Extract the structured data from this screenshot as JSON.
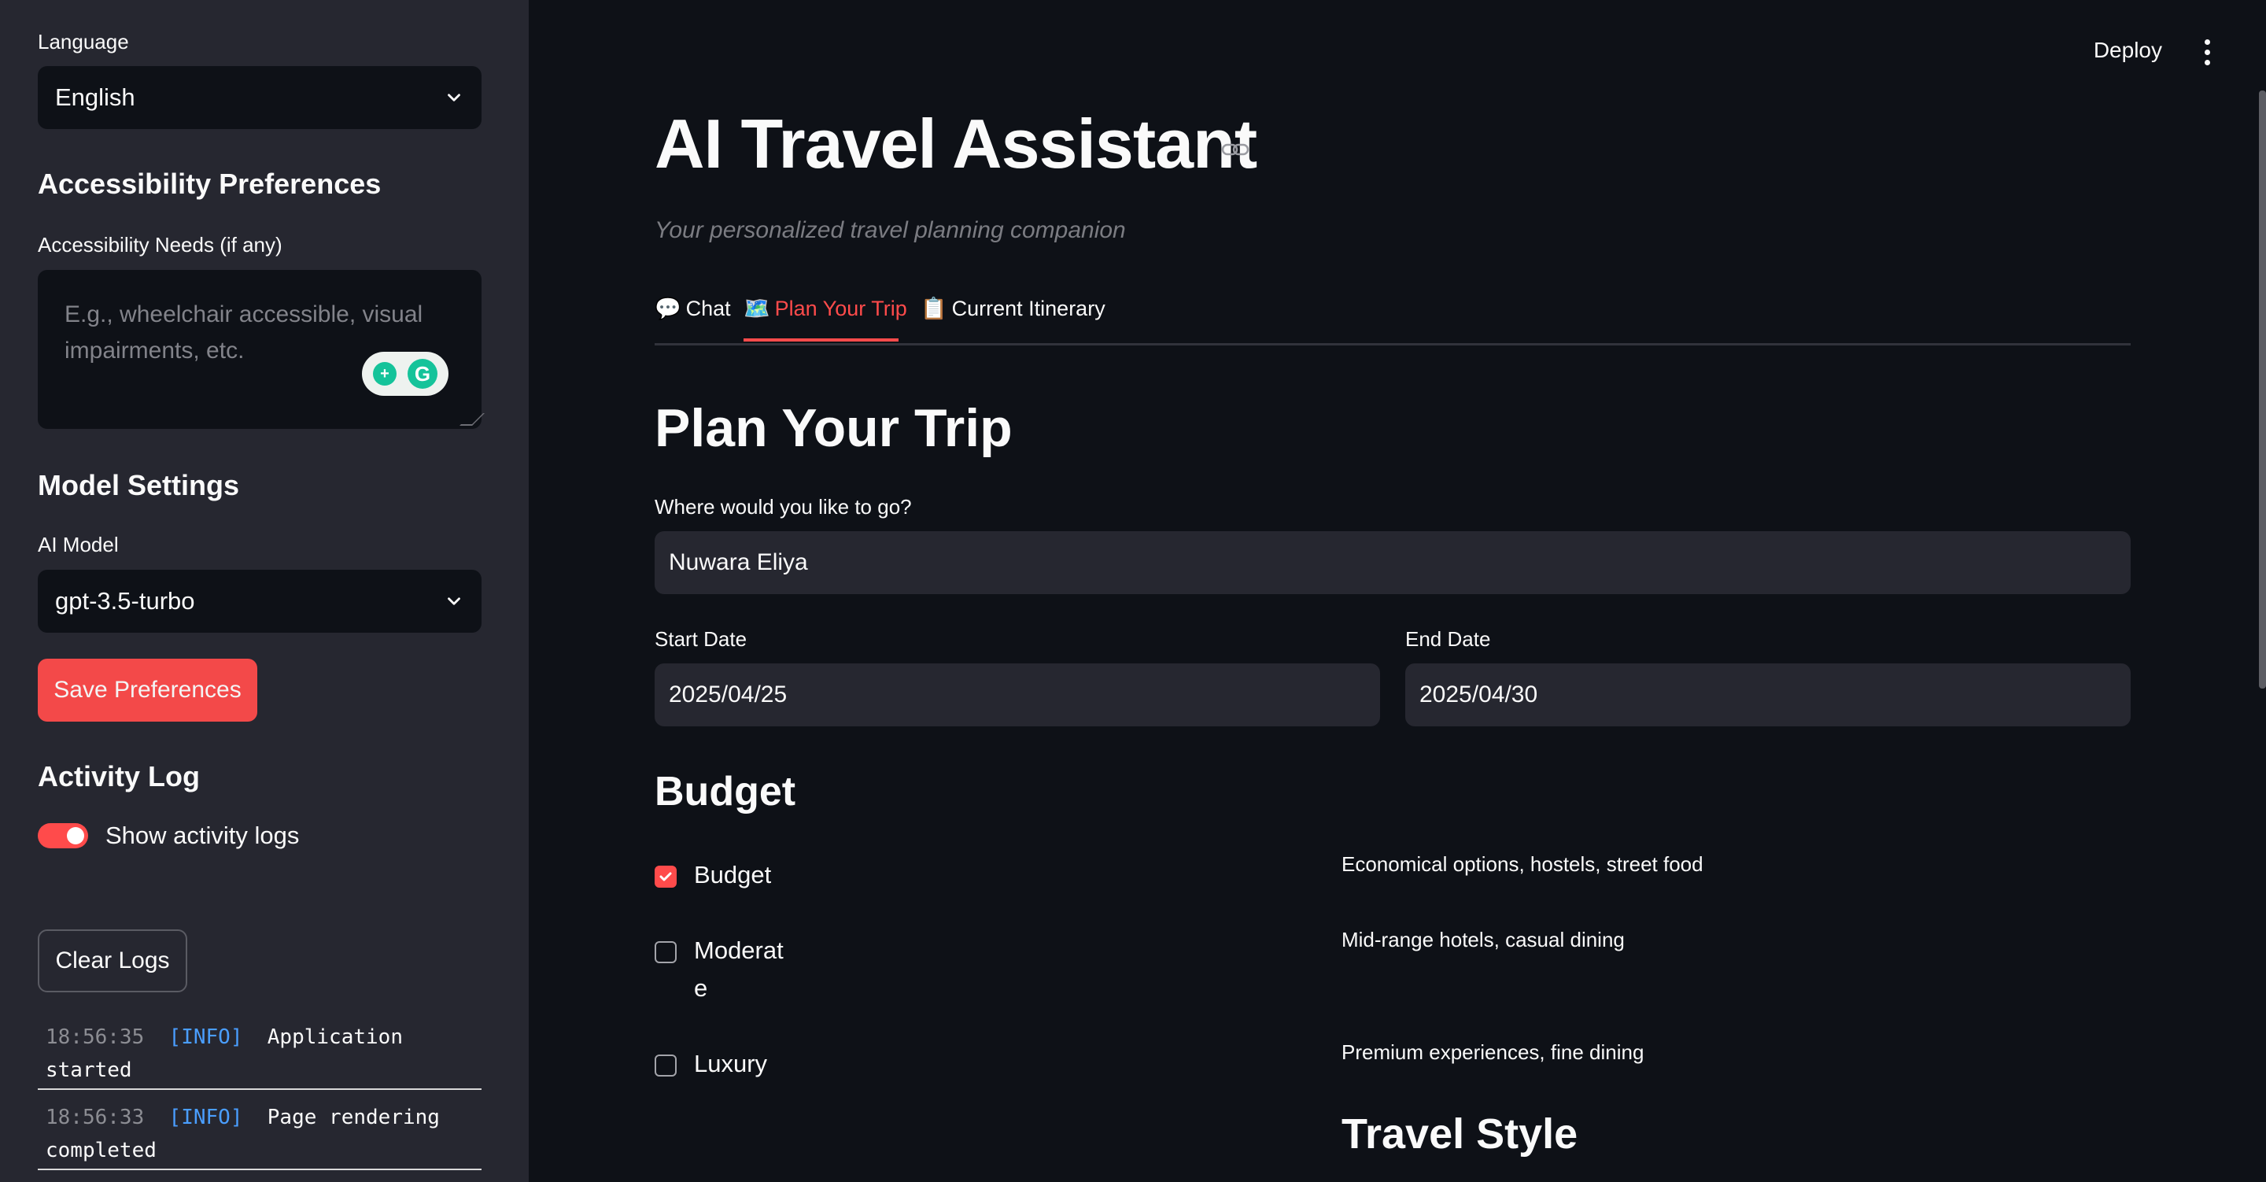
{
  "sidebar": {
    "language_label": "Language",
    "language_value": "English",
    "accessibility_heading": "Accessibility Preferences",
    "accessibility_label": "Accessibility Needs (if any)",
    "accessibility_placeholder": "E.g., wheelchair accessible, visual impairments, etc.",
    "model_heading": "Model Settings",
    "model_label": "AI Model",
    "model_value": "gpt-3.5-turbo",
    "save_button": "Save Preferences",
    "activity_heading": "Activity Log",
    "toggle_label": "Show activity logs",
    "toggle_on": true,
    "clear_button": "Clear Logs",
    "logs": [
      {
        "time": "18:56:35",
        "level": "[INFO]",
        "message": "Application started"
      },
      {
        "time": "18:56:33",
        "level": "[INFO]",
        "message": "Page rendering completed"
      }
    ]
  },
  "header": {
    "deploy": "Deploy",
    "menu_icon": "kebab-menu-icon"
  },
  "main": {
    "title": "AI Travel Assistant",
    "subtitle": "Your personalized travel planning companion",
    "tabs": [
      {
        "icon": "💬",
        "label": "Chat",
        "active": false
      },
      {
        "icon": "🗺️",
        "label": "Plan Your Trip",
        "active": true
      },
      {
        "icon": "📋",
        "label": "Current Itinerary",
        "active": false
      }
    ],
    "section_title": "Plan Your Trip",
    "destination_label": "Where would you like to go?",
    "destination_value": "Nuwara Eliya",
    "start_label": "Start Date",
    "start_value": "2025/04/25",
    "end_label": "End Date",
    "end_value": "2025/04/30",
    "budget_heading": "Budget",
    "budget_options": [
      {
        "label": "Budget",
        "desc": "Economical options, hostels, street food",
        "checked": true
      },
      {
        "label": "Moderate",
        "desc": "Mid-range hotels, casual dining",
        "checked": false
      },
      {
        "label": "Luxury",
        "desc": "Premium experiences, fine dining",
        "checked": false
      }
    ],
    "travel_style_heading": "Travel Style"
  },
  "colors": {
    "accent": "#ff4b4b",
    "background": "#0e1117",
    "sidebar": "#262730"
  }
}
